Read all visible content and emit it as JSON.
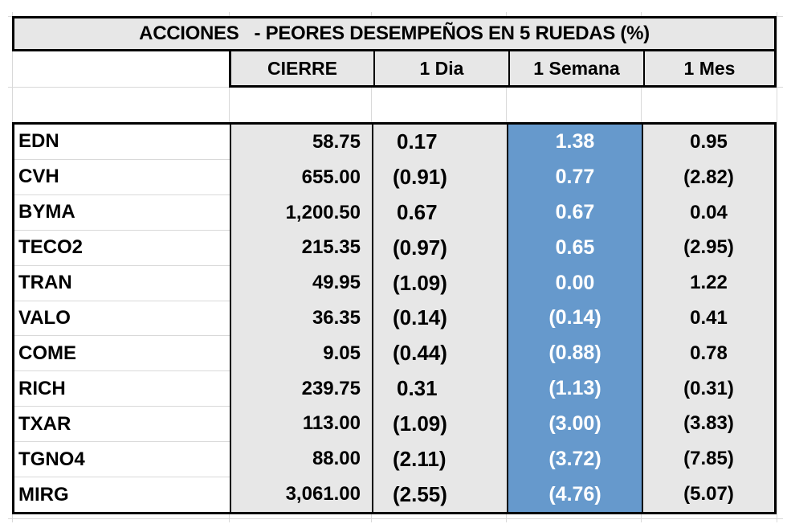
{
  "title": "ACCIONES   - PEORES DESEMPEÑOS EN 5 RUEDAS (%)",
  "colors": {
    "header_bg": "#e7e7e7",
    "highlight_column_bg": "#6699cc",
    "highlight_column_text": "#ffffff",
    "border": "#000000",
    "gridline": "#d9d9d9"
  },
  "headers": {
    "cierre": "CIERRE",
    "dia": "1 Dia",
    "semana": "1 Semana",
    "mes": "1 Mes"
  },
  "rows": [
    {
      "ticker": "EDN",
      "cierre": "58.75",
      "dia": "0.17",
      "semana": "1.38",
      "mes": "0.95"
    },
    {
      "ticker": "CVH",
      "cierre": "655.00",
      "dia": "(0.91)",
      "semana": "0.77",
      "mes": "(2.82)"
    },
    {
      "ticker": "BYMA",
      "cierre": "1,200.50",
      "dia": "0.67",
      "semana": "0.67",
      "mes": "0.04"
    },
    {
      "ticker": "TECO2",
      "cierre": "215.35",
      "dia": "(0.97)",
      "semana": "0.65",
      "mes": "(2.95)"
    },
    {
      "ticker": "TRAN",
      "cierre": "49.95",
      "dia": "(1.09)",
      "semana": "0.00",
      "mes": "1.22"
    },
    {
      "ticker": "VALO",
      "cierre": "36.35",
      "dia": "(0.14)",
      "semana": "(0.14)",
      "mes": "0.41"
    },
    {
      "ticker": "COME",
      "cierre": "9.05",
      "dia": "(0.44)",
      "semana": "(0.88)",
      "mes": "0.78"
    },
    {
      "ticker": "RICH",
      "cierre": "239.75",
      "dia": "0.31",
      "semana": "(1.13)",
      "mes": "(0.31)"
    },
    {
      "ticker": "TXAR",
      "cierre": "113.00",
      "dia": "(1.09)",
      "semana": "(3.00)",
      "mes": "(3.83)"
    },
    {
      "ticker": "TGNO4",
      "cierre": "88.00",
      "dia": "(2.11)",
      "semana": "(3.72)",
      "mes": "(7.85)"
    },
    {
      "ticker": "MIRG",
      "cierre": "3,061.00",
      "dia": "(2.55)",
      "semana": "(4.76)",
      "mes": "(5.07)"
    }
  ]
}
